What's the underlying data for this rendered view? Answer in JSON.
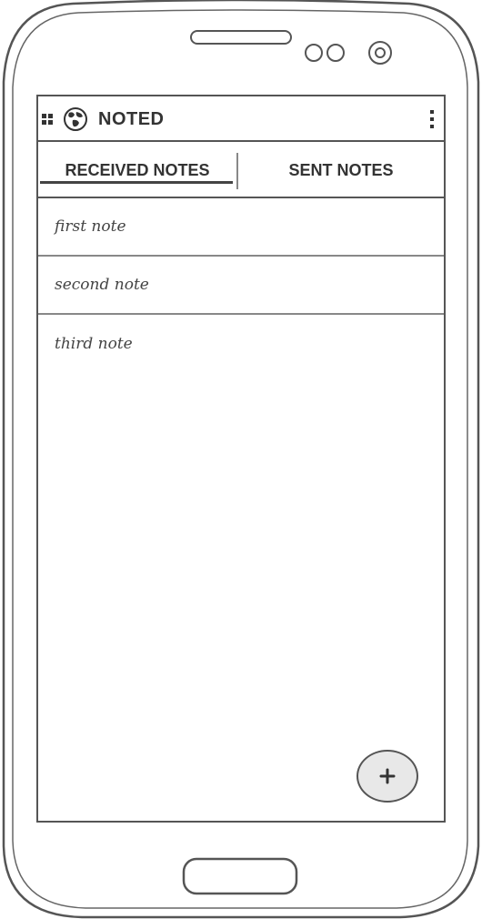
{
  "app": {
    "title": "NOTED"
  },
  "tabs": {
    "received_label": "RECEIVED NOTES",
    "sent_label": "SENT NOTES",
    "active": "received"
  },
  "notes": [
    {
      "text": "first note"
    },
    {
      "text": "second note"
    },
    {
      "text": "third note"
    }
  ],
  "icons": {
    "menu": "grid-icon",
    "logo": "globe-icon",
    "more": "overflow-menu-icon",
    "add": "plus-icon"
  },
  "colors": {
    "outline": "#555555",
    "fab_fill": "#e8e8e8"
  }
}
